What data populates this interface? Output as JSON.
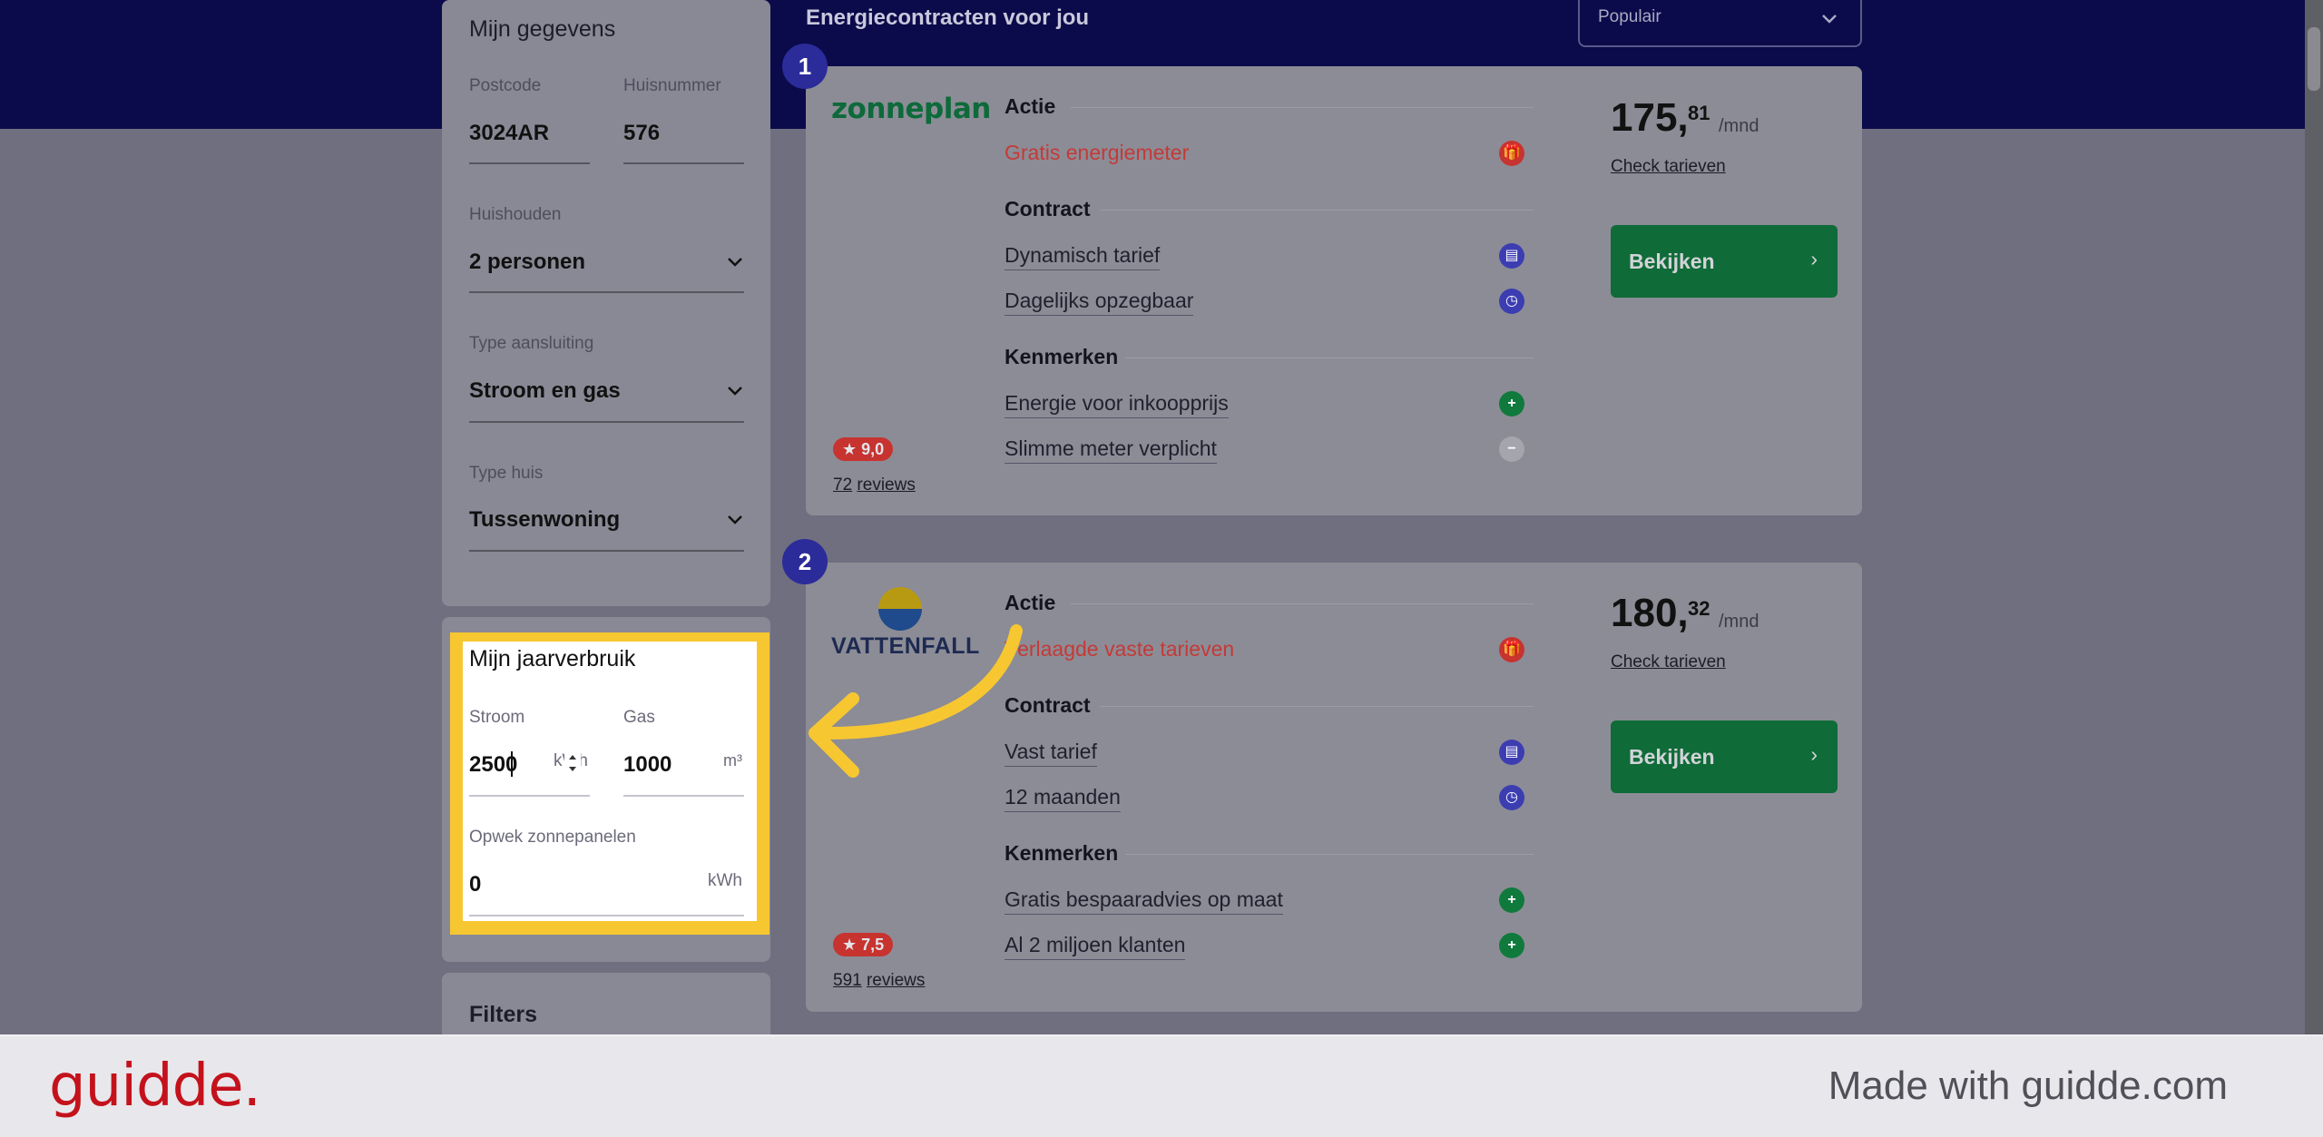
{
  "header": {
    "title": "Energiecontracten voor jou",
    "sort_value": "Populair"
  },
  "sidebar": {
    "mijn_gegevens": {
      "title": "Mijn gegevens",
      "postcode_label": "Postcode",
      "postcode_value": "3024AR",
      "huisnummer_label": "Huisnummer",
      "huisnummer_value": "576",
      "huishouden_label": "Huishouden",
      "huishouden_value": "2 personen",
      "aansluiting_label": "Type aansluiting",
      "aansluiting_value": "Stroom en gas",
      "typehuis_label": "Type huis",
      "typehuis_value": "Tussenwoning"
    },
    "jaarverbruik": {
      "title": "Mijn jaarverbruik",
      "stroom_label": "Stroom",
      "stroom_value": "2500",
      "stroom_unit": "kWh",
      "gas_label": "Gas",
      "gas_value": "1000",
      "gas_unit": "m³",
      "opwek_label": "Opwek zonnepanelen",
      "opwek_value": "0",
      "opwek_unit": "kWh"
    },
    "filters": {
      "title": "Filters"
    }
  },
  "cards": [
    {
      "rank": "1",
      "brand": "zonneplan",
      "actie_title": "Actie",
      "actie": "Gratis energiemeter",
      "contract_title": "Contract",
      "contract_items": [
        "Dynamisch tarief",
        "Dagelijks opzegbaar"
      ],
      "kenmerken_title": "Kenmerken",
      "kenmerken_items": [
        "Energie voor inkoopprijs",
        "Slimme meter verplicht"
      ],
      "price_main": "175,",
      "price_cents": "81",
      "price_unit": "/mnd",
      "check_label": "Check tarieven",
      "button_label": "Bekijken",
      "rating": "9,0",
      "reviews_count": "72",
      "reviews_label": "reviews"
    },
    {
      "rank": "2",
      "brand": "VATTENFALL",
      "actie_title": "Actie",
      "actie": "Verlaagde vaste tarieven",
      "contract_title": "Contract",
      "contract_items": [
        "Vast tarief",
        "12 maanden"
      ],
      "kenmerken_title": "Kenmerken",
      "kenmerken_items": [
        "Gratis bespaaradvies op maat",
        "Al 2 miljoen klanten"
      ],
      "price_main": "180,",
      "price_cents": "32",
      "price_unit": "/mnd",
      "check_label": "Check tarieven",
      "button_label": "Bekijken",
      "rating": "7,5",
      "reviews_count": "591",
      "reviews_label": "reviews"
    }
  ],
  "footer": {
    "logo": "guidde.",
    "made_with": "Made with guidde.com"
  },
  "colors": {
    "highlight": "#f7c731",
    "brand_green": "#0f6b38",
    "promo_red": "#c43a37",
    "rank_blue": "#2b2b9a",
    "guidde_red": "#c4121c"
  }
}
